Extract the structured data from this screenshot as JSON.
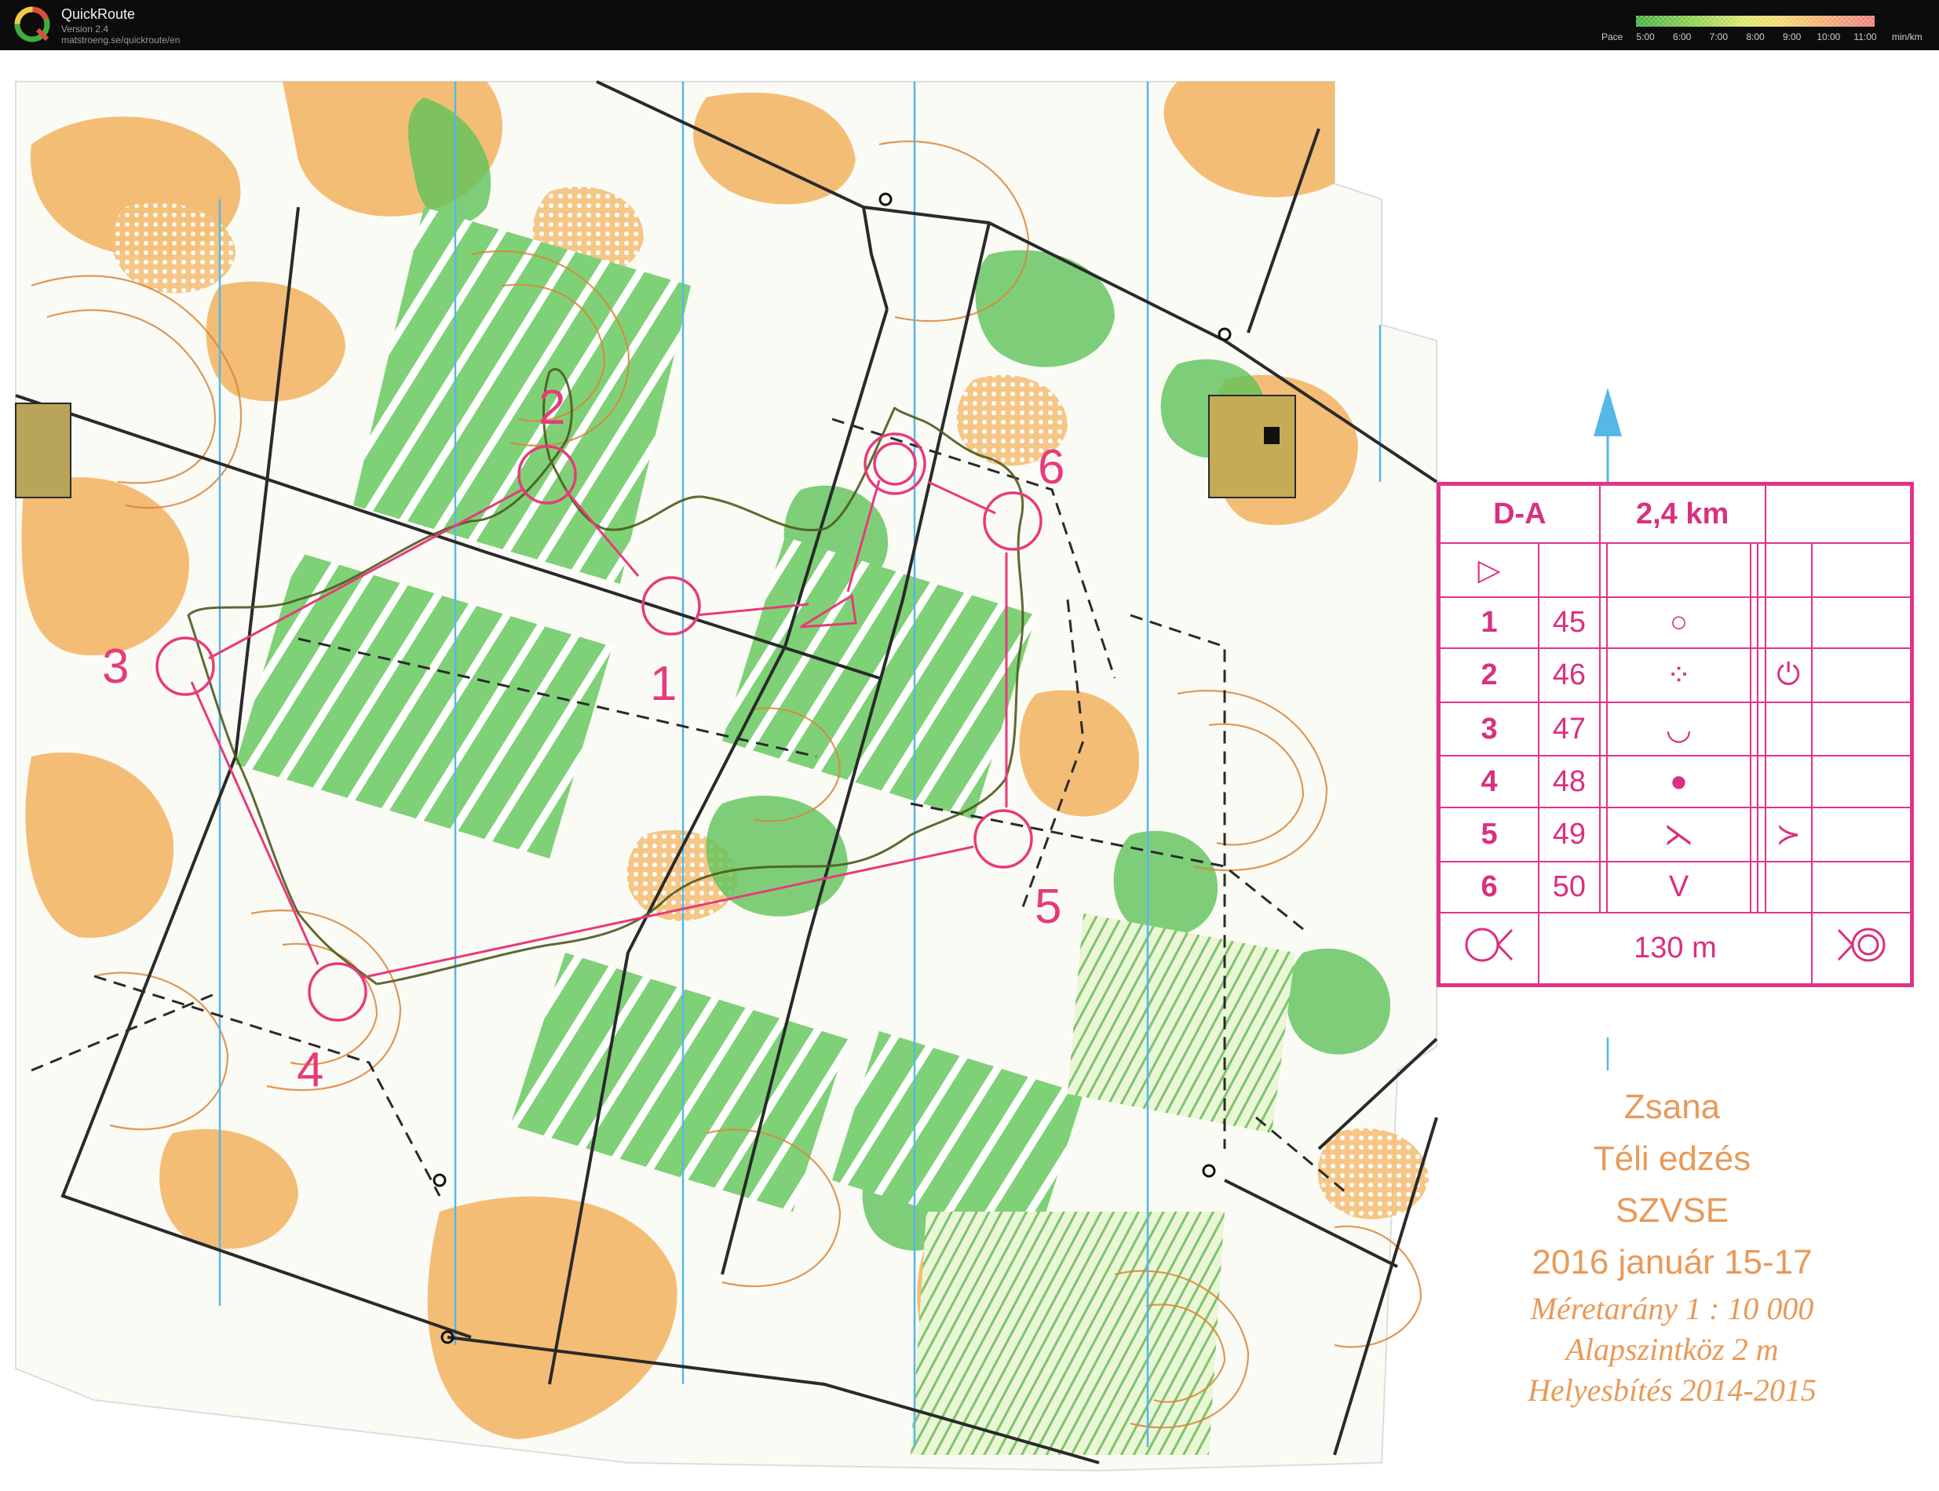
{
  "app": {
    "title": "QuickRoute",
    "version": "Version 2.4",
    "url": "matstroeng.se/quickroute/en"
  },
  "pace_legend": {
    "label": "Pace",
    "ticks": [
      "5:00",
      "6:00",
      "7:00",
      "8:00",
      "9:00",
      "10:00",
      "11:00"
    ],
    "unit": "min/km",
    "colors": [
      "#3fae3c",
      "#8fcf4a",
      "#d9e36a",
      "#f1d86a",
      "#f2a970",
      "#ee7a7a"
    ]
  },
  "map": {
    "colors": {
      "open_land": "#f2b25e",
      "vegetation": "#5fc35a",
      "contour": "#d9863a",
      "magnetic_north_line": "#55b8e6",
      "course": "#e63b7a",
      "route": "#4d5a1e",
      "track": "#2a2a2a"
    },
    "controls": [
      {
        "number": "1",
        "code": "45"
      },
      {
        "number": "2",
        "code": "46"
      },
      {
        "number": "3",
        "code": "47"
      },
      {
        "number": "4",
        "code": "48"
      },
      {
        "number": "5",
        "code": "49"
      },
      {
        "number": "6",
        "code": "50"
      }
    ]
  },
  "control_card": {
    "course": "D-A",
    "length": "2,4 km",
    "rows": [
      {
        "number": "1",
        "code": "45",
        "symbol": "○"
      },
      {
        "number": "2",
        "code": "46",
        "symbol": "⁘",
        "extra": "⏻"
      },
      {
        "number": "3",
        "code": "47",
        "symbol": "◡"
      },
      {
        "number": "4",
        "code": "48",
        "symbol": "●"
      },
      {
        "number": "5",
        "code": "49",
        "symbol": "⋋",
        "extra": "≻"
      },
      {
        "number": "6",
        "code": "50",
        "symbol": "V"
      }
    ],
    "start_symbol": "▷",
    "finish_distance": "130 m"
  },
  "map_info": {
    "area": "Zsana",
    "event": "Téli edzés",
    "club": "SZVSE",
    "date": "2016 január 15-17",
    "scale": "Méretarány  1 : 10 000",
    "contour": "Alapszintköz  2 m",
    "revision": "Helyesbítés 2014-2015"
  }
}
